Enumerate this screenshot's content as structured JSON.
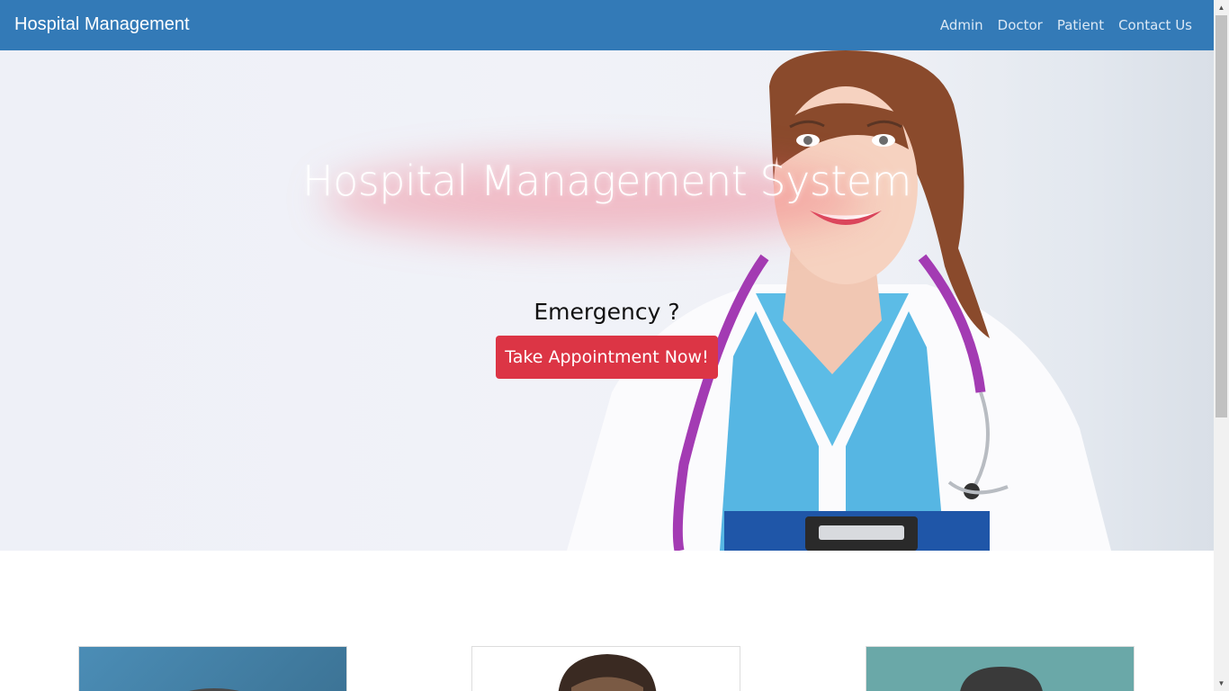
{
  "navbar": {
    "brand": "Hospital Management",
    "links": [
      "Admin",
      "Doctor",
      "Patient",
      "Contact Us"
    ]
  },
  "hero": {
    "title": "Hospital Management System",
    "emergency": "Emergency ?",
    "cta": "Take Appointment Now!"
  },
  "colors": {
    "navbar": "#337ab7",
    "cta": "#dc3545"
  },
  "icons": {
    "scroll_up": "up-arrow-icon",
    "scroll_down": "down-arrow-icon"
  }
}
